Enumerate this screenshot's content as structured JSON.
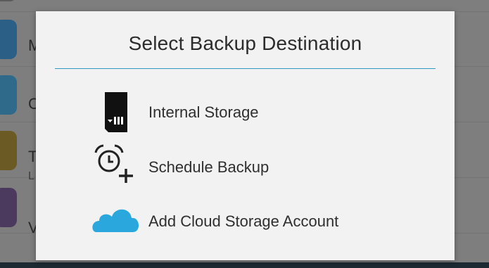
{
  "background": {
    "rows": [
      {
        "letter": "M",
        "sub": ""
      },
      {
        "letter": "C",
        "sub": ""
      },
      {
        "letter": "T",
        "sub": "L"
      },
      {
        "letter": "V",
        "sub": ""
      }
    ]
  },
  "dialog": {
    "title": "Select Backup Destination",
    "accent_color": "#2f9ac4",
    "options": [
      {
        "label": "Internal Storage",
        "icon": "sd-card-icon"
      },
      {
        "label": "Schedule Backup",
        "icon": "alarm-clock-plus-icon"
      },
      {
        "label": "Add Cloud Storage Account",
        "icon": "cloud-icon"
      }
    ]
  }
}
